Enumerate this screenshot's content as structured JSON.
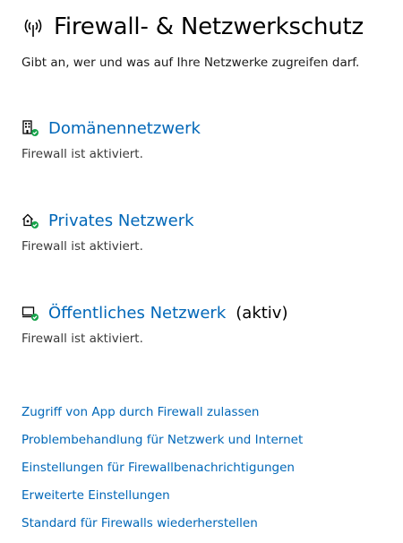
{
  "header": {
    "title": "Firewall- & Netzwerkschutz",
    "icon": "wireless-signal-icon"
  },
  "subtitle": "Gibt an, wer und was auf Ihre Netzwerke zugreifen darf.",
  "networks": [
    {
      "name": "Domänennetzwerk",
      "status": "Firewall ist aktiviert.",
      "active_label": "",
      "icon": "domain-building-icon"
    },
    {
      "name": "Privates Netzwerk",
      "status": "Firewall ist aktiviert.",
      "active_label": "",
      "icon": "private-home-icon"
    },
    {
      "name": "Öffentliches Netzwerk",
      "status": "Firewall ist aktiviert.",
      "active_label": "(aktiv)",
      "icon": "public-network-icon"
    }
  ],
  "links": [
    "Zugriff von App durch Firewall zulassen",
    "Problembehandlung für Netzwerk und Internet",
    "Einstellungen für Firewallbenachrichtigungen",
    "Erweiterte Einstellungen",
    "Standard für Firewalls wiederherstellen"
  ],
  "colors": {
    "link": "#0067b8",
    "check_badge": "#16a34a",
    "text": "#000000"
  }
}
